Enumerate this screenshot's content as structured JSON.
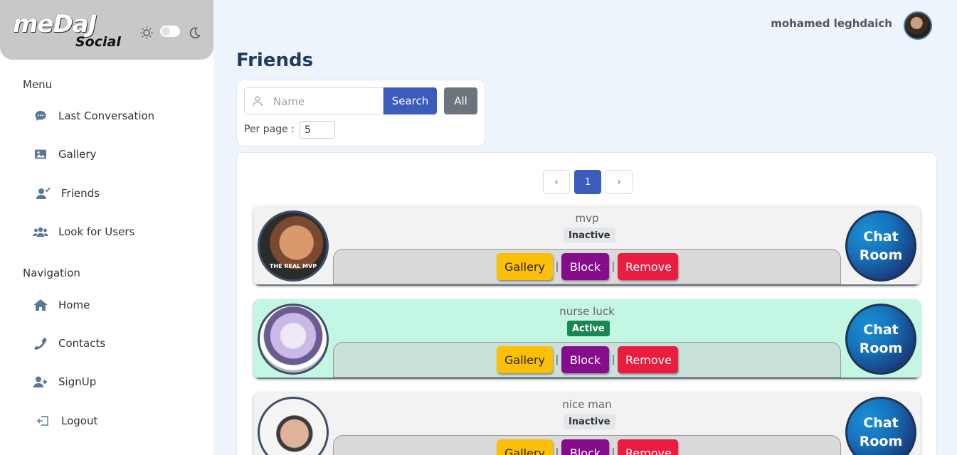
{
  "brand": {
    "logo_main": "meDaJ",
    "logo_sub": "Social"
  },
  "sidebar": {
    "menu_title": "Menu",
    "menu_items": [
      {
        "label": "Last Conversation",
        "icon": "chat-icon"
      },
      {
        "label": "Gallery",
        "icon": "image-icon"
      },
      {
        "label": "Friends",
        "icon": "user-check-icon"
      },
      {
        "label": "Look for Users",
        "icon": "users-icon"
      }
    ],
    "nav_title": "Navigation",
    "nav_items": [
      {
        "label": "Home",
        "icon": "home-icon"
      },
      {
        "label": "Contacts",
        "icon": "phone-icon"
      },
      {
        "label": "SignUp",
        "icon": "user-plus-icon"
      },
      {
        "label": "Logout",
        "icon": "logout-icon"
      }
    ]
  },
  "header": {
    "user_name": "mohamed leghdaich"
  },
  "page": {
    "title": "Friends"
  },
  "search": {
    "placeholder": "Name",
    "value": "",
    "search_label": "Search",
    "all_label": "All",
    "per_page_label": "Per page :",
    "per_page_value": "5"
  },
  "pagination": {
    "prev": "‹",
    "current": "1",
    "next": "›"
  },
  "friends": [
    {
      "name": "mvp",
      "status": "Inactive",
      "avatar_caption": "THE REAL MVP",
      "gallery": "Gallery",
      "block": "Block",
      "remove": "Remove",
      "chat": "Chat Room"
    },
    {
      "name": "nurse luck",
      "status": "Active",
      "avatar_caption": "",
      "gallery": "Gallery",
      "block": "Block",
      "remove": "Remove",
      "chat": "Chat Room"
    },
    {
      "name": "nice man",
      "status": "Inactive",
      "avatar_caption": "",
      "gallery": "Gallery",
      "block": "Block",
      "remove": "Remove",
      "chat": "Chat Room"
    }
  ],
  "separator": "|",
  "colors": {
    "primary": "#3b5cbb",
    "secondary": "#6c757d",
    "gallery": "#fcbf07",
    "block": "#850c8a",
    "remove": "#ea1c3f",
    "active_badge": "#198754",
    "active_card": "#c3f7e3",
    "title": "#1e3a5f"
  }
}
